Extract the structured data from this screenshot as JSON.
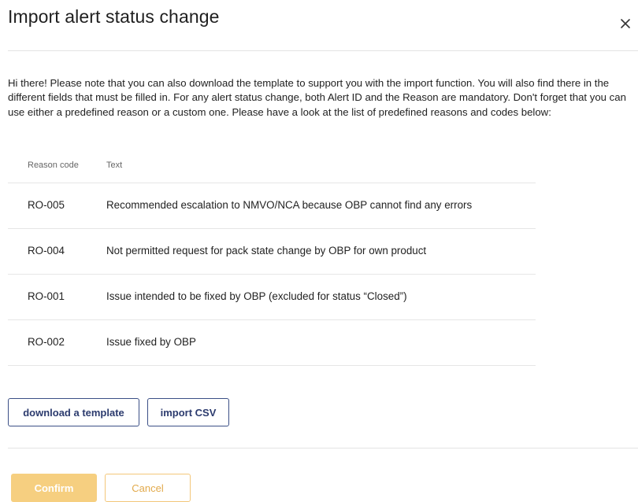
{
  "dialog": {
    "title": "Import alert status change",
    "close_icon": "close-icon"
  },
  "intro_text": "Hi there! Please note that you can also download the template to support you with the import function. You will also find there in the different fields that must be filled in. For any alert status change, both Alert ID and the Reason are mandatory. Don't forget that you can use either a predefined reason or a custom one. Please have a look at the list of predefined reasons and codes below:",
  "table": {
    "headers": {
      "code": "Reason code",
      "text": "Text"
    },
    "rows": [
      {
        "code": "RO-005",
        "text": "Recommended escalation to NMVO/NCA because OBP cannot find any errors"
      },
      {
        "code": "RO-004",
        "text": "Not permitted request for pack state change by OBP for own product"
      },
      {
        "code": "RO-001",
        "text": "Issue intended to be fixed by OBP (excluded for status “Closed”)"
      },
      {
        "code": "RO-002",
        "text": "Issue fixed by OBP"
      }
    ]
  },
  "actions": {
    "download_label": "download a template",
    "import_label": "import CSV"
  },
  "footer": {
    "confirm_label": "Confirm",
    "cancel_label": "Cancel"
  },
  "colors": {
    "primary_outline": "#3b4f86",
    "confirm_bg": "#f6cf80",
    "cancel_border": "#f3c77a",
    "cancel_text": "#e2aa4c"
  }
}
